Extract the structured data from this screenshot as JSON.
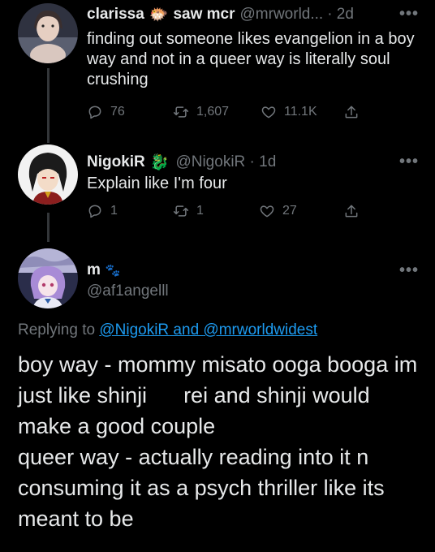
{
  "tweet1": {
    "display_name": "clarissa",
    "emoji": "🐡",
    "emoji_icon": "pufferfish-emoji-icon",
    "name_suffix": "saw mcr",
    "handle": "@mrworld...",
    "time": "· 2d",
    "more": "•••",
    "text": "finding out someone likes evangelion in a boy way and not in a queer way is literally soul crushing",
    "replies": "76",
    "retweets": "1,607",
    "likes": "11.1K"
  },
  "tweet2": {
    "display_name": "NigokiR",
    "emoji": "🐉",
    "emoji_icon": "dragon-emoji-icon",
    "handle": "@NigokiR · 1d",
    "more": "•••",
    "text": "Explain like I'm four",
    "replies": "1",
    "retweets": "1",
    "likes": "27"
  },
  "tweet3": {
    "display_name": "m",
    "emoji": "🐾",
    "emoji_icon": "paw-prints-emoji-icon",
    "handle": "@af1angelll",
    "more": "•••",
    "replying_prefix": "Replying to ",
    "replying_user1": "@NigokiR",
    "replying_and": " and ",
    "replying_user2": "@mrworldwidest",
    "text": "boy way - mommy misato ooga booga im just like shinji      rei and shinji would make a good couple\nqueer way - actually reading into it n consuming it as a psych thriller like its meant to be"
  },
  "colors": {
    "background": "#000000",
    "text": "#e7e9ea",
    "muted": "#71767b",
    "link": "#1d9bf0"
  }
}
